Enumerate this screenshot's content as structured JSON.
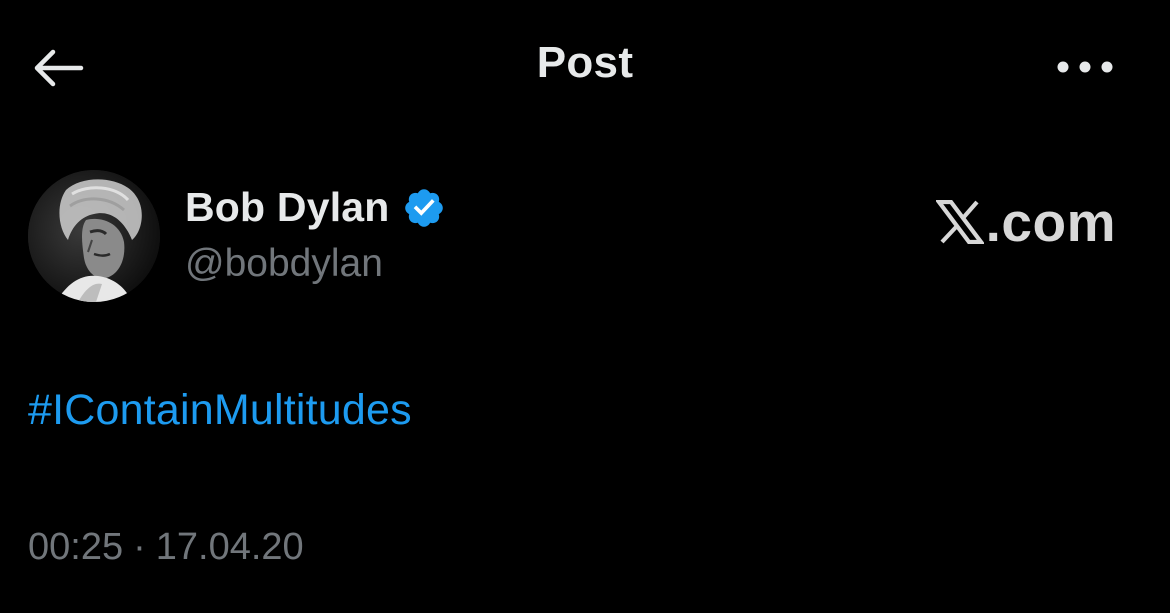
{
  "header": {
    "title": "Post",
    "back_icon": "arrow-left-icon",
    "more_icon": "more-horizontal-icon"
  },
  "author": {
    "name": "Bob Dylan",
    "handle": "@bobdylan",
    "verified_icon": "verified-badge-icon",
    "verified_color": "#1d9bf0"
  },
  "source": {
    "label": ".com",
    "logo_icon": "x-logo-icon"
  },
  "post": {
    "text": "#IContainMultitudes",
    "link_color": "#1d9bf0"
  },
  "meta": {
    "time": "00:25",
    "separator": "·",
    "date": "17.04.20"
  },
  "colors": {
    "background": "#000000",
    "primary_text": "#e7e9ea",
    "secondary_text": "#71767b"
  }
}
